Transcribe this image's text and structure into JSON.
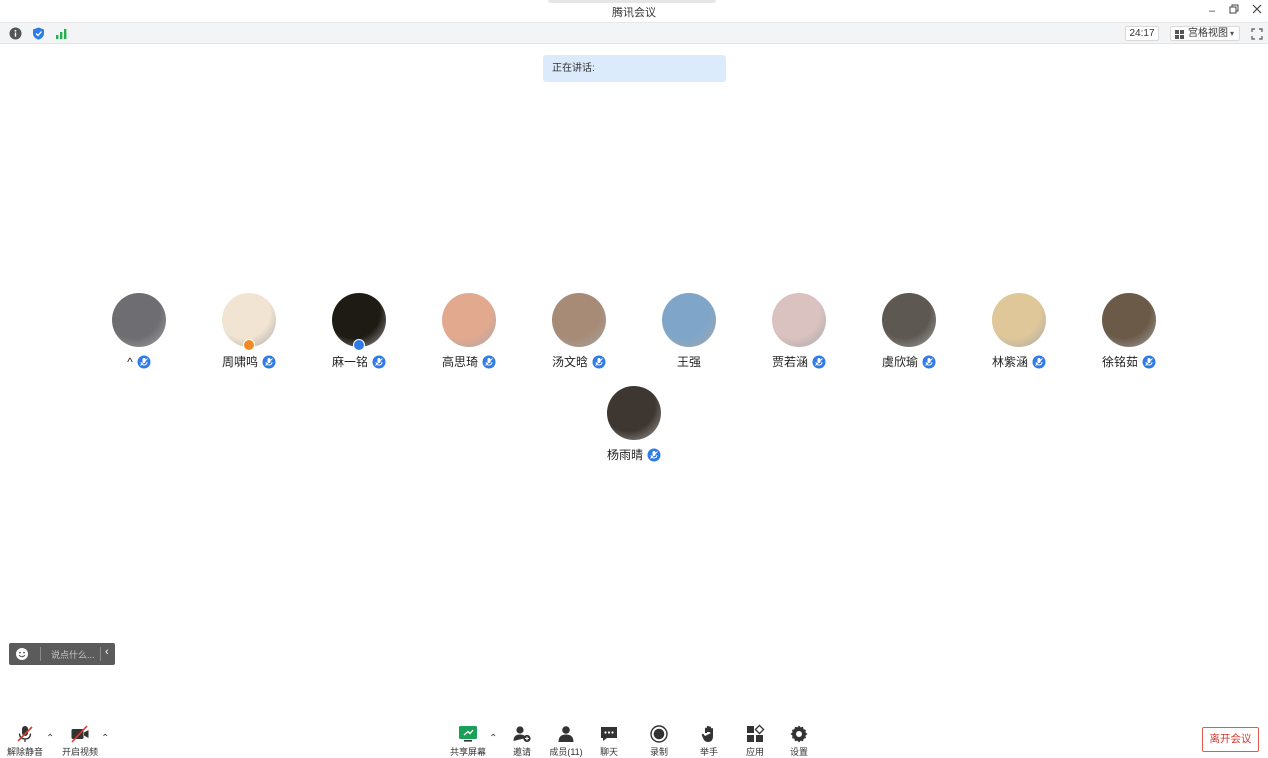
{
  "window": {
    "title": "腾讯会议",
    "controls": [
      "minimize",
      "restore",
      "close"
    ]
  },
  "toolbar": {
    "timer": "24:17",
    "view_label": "宫格视图",
    "icons": [
      "info-icon",
      "shield-icon",
      "signal-icon"
    ]
  },
  "speaking": {
    "label": "正在讲话:"
  },
  "participants": [
    {
      "name": "^",
      "avatar_color": "#6e6e72"
    },
    {
      "name": "周啸鸣",
      "avatar_color": "#f1e4d2",
      "host": true,
      "host_color": "#f08a24"
    },
    {
      "name": "麻一铭",
      "avatar_color": "#1e1a14",
      "host": true,
      "host_color": "#2f7bea"
    },
    {
      "name": "高思琦",
      "avatar_color": "#e3a98f"
    },
    {
      "name": "汤文晗",
      "avatar_color": "#a78b76"
    },
    {
      "name": "王强",
      "avatar_color": "#7fa6c8",
      "no_mic": true
    },
    {
      "name": "贾若涵",
      "avatar_color": "#d9c2bf"
    },
    {
      "name": "虞欣瑜",
      "avatar_color": "#5e5853"
    },
    {
      "name": "林紫涵",
      "avatar_color": "#e0c79a"
    },
    {
      "name": "徐铭茹",
      "avatar_color": "#6b5a48"
    },
    {
      "name": "杨雨晴",
      "avatar_color": "#3e3630"
    }
  ],
  "chat": {
    "placeholder": "说点什么..."
  },
  "controls": {
    "unmute": "解除静音",
    "start_video": "开启视频",
    "share_screen": "共享屏幕",
    "invite": "邀请",
    "members": "成员(11)",
    "chat": "聊天",
    "record": "录制",
    "raise_hand": "举手",
    "apps": "应用",
    "settings": "设置",
    "leave": "离开会议"
  },
  "colors": {
    "accent": "#2f7bea",
    "leave": "#d9382c",
    "share": "#18a058"
  }
}
